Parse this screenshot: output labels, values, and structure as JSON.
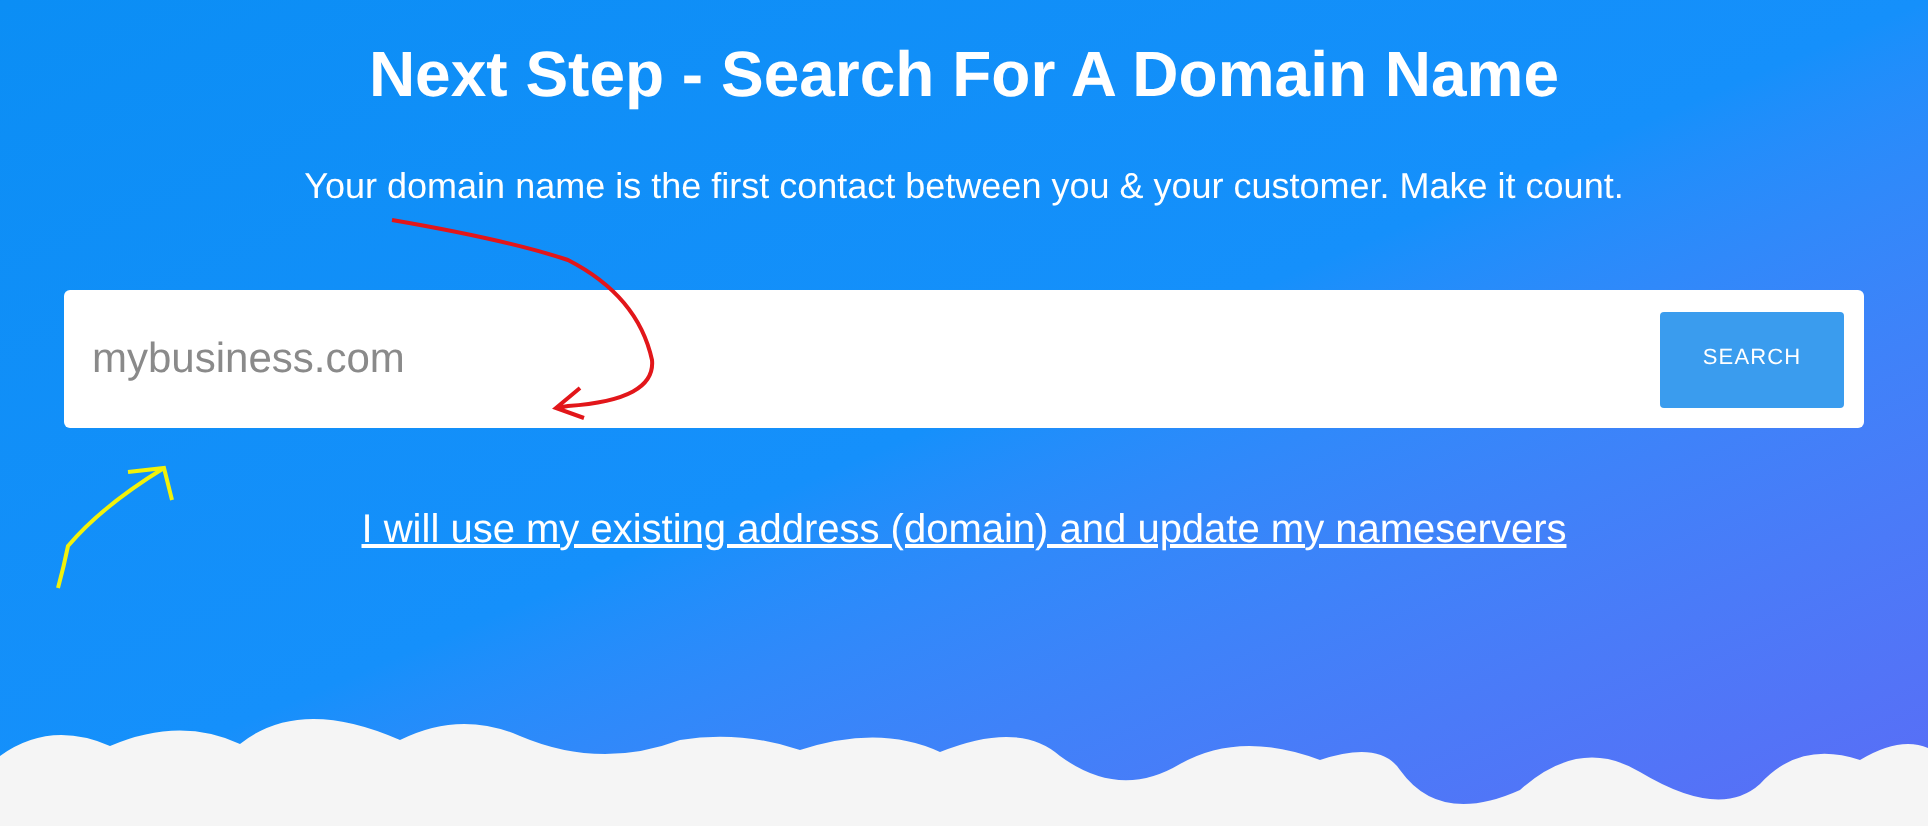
{
  "heading": "Next Step - Search For A Domain Name",
  "subheading": "Your domain name is the first contact between you & your customer. Make it count.",
  "search": {
    "placeholder": "mybusiness.com",
    "button": "SEARCH"
  },
  "link": "I will use my existing address (domain) and update my nameservers"
}
